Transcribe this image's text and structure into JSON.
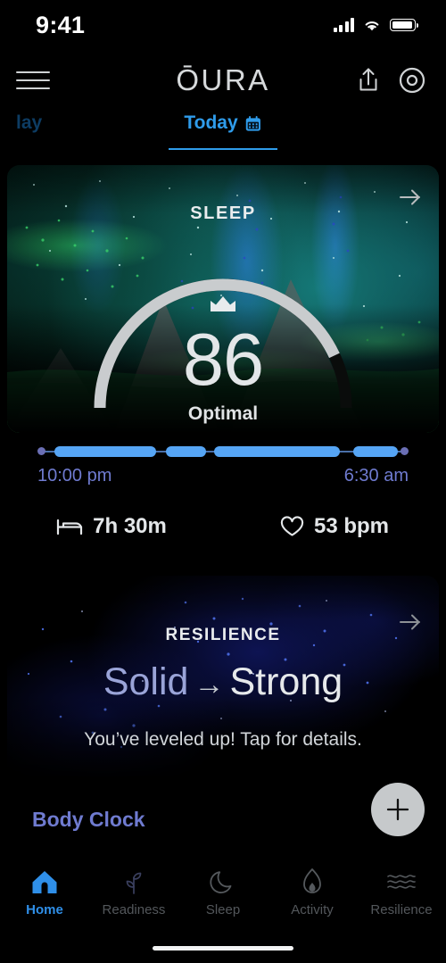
{
  "status_bar": {
    "time": "9:41",
    "cellular_icon": "cellular-bars-icon",
    "wifi_icon": "wifi-icon",
    "battery_icon": "battery-icon"
  },
  "header": {
    "menu_icon": "hamburger-menu-icon",
    "brand": "ŌURA",
    "share_icon": "share-icon",
    "ring_icon": "oura-ring-icon"
  },
  "tabs": {
    "previous": "lay",
    "today": "Today",
    "calendar_icon": "calendar-icon"
  },
  "sleep_card": {
    "label": "SLEEP",
    "score": "86",
    "state": "Optimal",
    "crown_icon": "crown-icon",
    "arrow_icon": "arrow-right-icon",
    "gauge_percent": 86,
    "gauge_fill_color": "#c9ccce",
    "gauge_track_color": "#0d0f0e",
    "timeline": {
      "start": "10:00 pm",
      "end": "6:30 am",
      "segment_color": "#56a5f5",
      "marker_color": "#6b6fb5",
      "segments": [
        {
          "left_pct": 3.5,
          "width_pct": 28.0
        },
        {
          "left_pct": 34.0,
          "width_pct": 11.5
        },
        {
          "left_pct": 47.0,
          "width_pct": 34.5
        },
        {
          "left_pct": 86.0,
          "width_pct": 0.0
        }
      ],
      "segments_right": [
        {
          "left_pct": 84.5,
          "width_pct": 12.5
        }
      ]
    },
    "stats": [
      {
        "icon": "bed-icon",
        "value": "7h 30m"
      },
      {
        "icon": "heart-icon",
        "value": "53 bpm"
      }
    ]
  },
  "resilience_card": {
    "label": "RESILIENCE",
    "from_level": "Solid",
    "transition_icon": "arrow-right-glyph",
    "to_level": "Strong",
    "subtitle": "You’ve leveled up! Tap for details.",
    "arrow_icon": "arrow-right-icon"
  },
  "body_clock": {
    "label": "Body Clock"
  },
  "fab": {
    "icon": "plus-icon"
  },
  "bottom_nav": {
    "items": [
      {
        "label": "Home",
        "icon": "home-icon",
        "active": true
      },
      {
        "label": "Readiness",
        "icon": "sprout-icon",
        "active": false
      },
      {
        "label": "Sleep",
        "icon": "moon-icon",
        "active": false
      },
      {
        "label": "Activity",
        "icon": "flame-icon",
        "active": false
      },
      {
        "label": "Resilience",
        "icon": "waves-icon",
        "active": false
      }
    ],
    "active_color": "#2f8fe8",
    "inactive_color": "#53575b"
  }
}
